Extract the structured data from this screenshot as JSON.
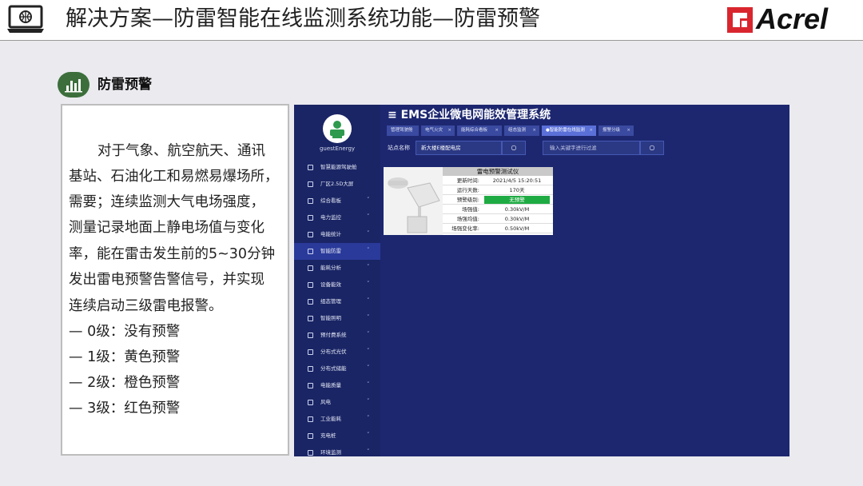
{
  "header": {
    "title": "解决方案—防雷智能在线监测系统功能—防雷预警",
    "brand": "Acrel",
    "brand_color": "#d9262e"
  },
  "section": {
    "title": "防雷预警",
    "icon": "bar-chart-icon"
  },
  "textbox": {
    "lines": [
      "对于气象、航空航天、通讯",
      "基站、石油化工和易燃易爆场所，",
      "需要；连续监测大气电场强度，",
      "测量记录地面上静电场值与变化",
      "率，能在雷击发生前的5~30分钟",
      "发出雷电预警告警信号，并实现",
      "连续启动三级雷电报警。",
      " — 0级：没有预警",
      "— 1级：黄色预警",
      "— 2级：橙色预警",
      "— 3级：红色预警"
    ]
  },
  "app": {
    "title": "EMS企业微电网能效管理系统",
    "user": "guestEnergy",
    "nav": [
      {
        "label": "智慧能源驾驶舱",
        "chevron": ""
      },
      {
        "label": "厂区2.5D大屏",
        "chevron": ""
      },
      {
        "label": "综合看板",
        "chevron": "˅"
      },
      {
        "label": "电力监控",
        "chevron": "˅"
      },
      {
        "label": "电能统计",
        "chevron": "˅"
      },
      {
        "label": "智能防雷",
        "chevron": "˅"
      },
      {
        "label": "能耗分析",
        "chevron": "˅"
      },
      {
        "label": "设备能效",
        "chevron": "˅"
      },
      {
        "label": "组态管理",
        "chevron": "˅"
      },
      {
        "label": "智能照明",
        "chevron": "˅"
      },
      {
        "label": "预付费系统",
        "chevron": "˅"
      },
      {
        "label": "分布式光伏",
        "chevron": "˅"
      },
      {
        "label": "分布式储能",
        "chevron": "˅"
      },
      {
        "label": "电能质量",
        "chevron": "˅"
      },
      {
        "label": "风电",
        "chevron": "˅"
      },
      {
        "label": "工业能耗",
        "chevron": "˅"
      },
      {
        "label": "充电桩",
        "chevron": "˅"
      },
      {
        "label": "环境监测",
        "chevron": "˅"
      }
    ],
    "tabs": [
      {
        "label": "管理驾驶舱",
        "close": ""
      },
      {
        "label": "电气火灾",
        "close": "×"
      },
      {
        "label": "能耗综合看板",
        "close": "×"
      },
      {
        "label": "组态监测",
        "close": "×"
      },
      {
        "label": "●智能防雷在线监测",
        "close": "×"
      },
      {
        "label": "报警分级",
        "close": "×"
      }
    ],
    "search": {
      "label": "站点名称",
      "value": "新大楼E楼配电房",
      "keyword_placeholder": "输入关键字进行过滤"
    },
    "card": {
      "title": "雷电预警测试仪",
      "rows": [
        {
          "key": "更新时间:",
          "value": "2021/4/5   15:20:51"
        },
        {
          "key": "运行天数:",
          "value": "170天"
        },
        {
          "key": "预警级别:",
          "value": "无预警"
        },
        {
          "key": "场强值:",
          "value": "0.30kV/M"
        },
        {
          "key": "场强均值:",
          "value": "0.30kV/M"
        },
        {
          "key": "场强变化率:",
          "value": "0.50kV/M"
        }
      ]
    }
  }
}
